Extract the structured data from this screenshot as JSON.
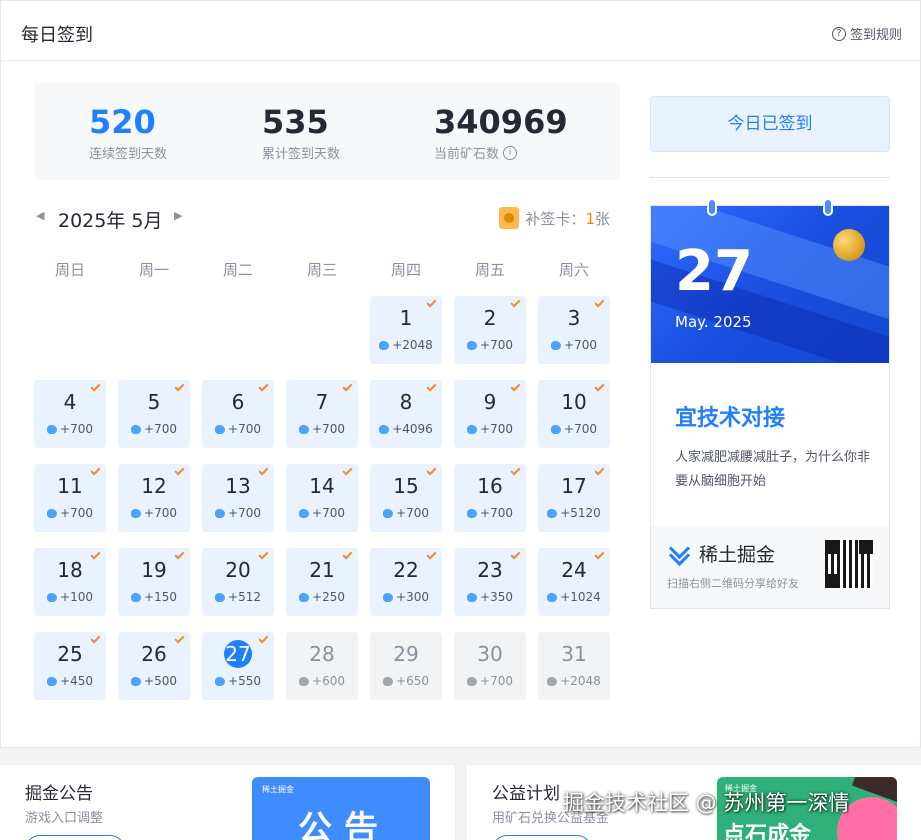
{
  "header": {
    "title": "每日签到",
    "rules_label": "签到规则",
    "rules_icon": "question-circle-icon"
  },
  "stats": {
    "streak": {
      "value": "520",
      "label": "连续签到天数"
    },
    "total": {
      "value": "535",
      "label": "累计签到天数"
    },
    "ore": {
      "value": "340969",
      "label": "当前矿石数",
      "info_icon": "i"
    }
  },
  "calendar": {
    "month_label": "2025年 5月",
    "prev_icon": "◀",
    "next_icon": "▶",
    "makeup_label": "补签卡：",
    "makeup_count": "1",
    "makeup_unit": "张",
    "weekdays": [
      "周日",
      "周一",
      "周二",
      "周三",
      "周四",
      "周五",
      "周六"
    ],
    "first_weekday_index": 4,
    "today": 27,
    "days": [
      {
        "day": "1",
        "reward": "+2048",
        "signed": true
      },
      {
        "day": "2",
        "reward": "+700",
        "signed": true
      },
      {
        "day": "3",
        "reward": "+700",
        "signed": true
      },
      {
        "day": "4",
        "reward": "+700",
        "signed": true
      },
      {
        "day": "5",
        "reward": "+700",
        "signed": true
      },
      {
        "day": "6",
        "reward": "+700",
        "signed": true
      },
      {
        "day": "7",
        "reward": "+700",
        "signed": true
      },
      {
        "day": "8",
        "reward": "+4096",
        "signed": true
      },
      {
        "day": "9",
        "reward": "+700",
        "signed": true
      },
      {
        "day": "10",
        "reward": "+700",
        "signed": true
      },
      {
        "day": "11",
        "reward": "+700",
        "signed": true
      },
      {
        "day": "12",
        "reward": "+700",
        "signed": true
      },
      {
        "day": "13",
        "reward": "+700",
        "signed": true
      },
      {
        "day": "14",
        "reward": "+700",
        "signed": true
      },
      {
        "day": "15",
        "reward": "+700",
        "signed": true
      },
      {
        "day": "16",
        "reward": "+700",
        "signed": true
      },
      {
        "day": "17",
        "reward": "+5120",
        "signed": true
      },
      {
        "day": "18",
        "reward": "+100",
        "signed": true
      },
      {
        "day": "19",
        "reward": "+150",
        "signed": true
      },
      {
        "day": "20",
        "reward": "+512",
        "signed": true
      },
      {
        "day": "21",
        "reward": "+250",
        "signed": true
      },
      {
        "day": "22",
        "reward": "+300",
        "signed": true
      },
      {
        "day": "23",
        "reward": "+350",
        "signed": true
      },
      {
        "day": "24",
        "reward": "+1024",
        "signed": true
      },
      {
        "day": "25",
        "reward": "+450",
        "signed": true
      },
      {
        "day": "26",
        "reward": "+500",
        "signed": true
      },
      {
        "day": "27",
        "reward": "+550",
        "signed": true
      },
      {
        "day": "28",
        "reward": "+600",
        "signed": false
      },
      {
        "day": "29",
        "reward": "+650",
        "signed": false
      },
      {
        "day": "30",
        "reward": "+700",
        "signed": false
      },
      {
        "day": "31",
        "reward": "+2048",
        "signed": false
      }
    ]
  },
  "sidebar": {
    "signed_button": "今日已签到",
    "promo": {
      "day": "27",
      "month_year": "May. 2025",
      "headline": "宜技术对接",
      "description": "人家减肥减腰减肚子，为什么你非要从脑细胞开始",
      "brand": "稀土掘金",
      "share_hint": "扫描右侧二维码分享给好友"
    }
  },
  "bottom": {
    "left": {
      "title": "掘金公告",
      "subtitle": "游戏入口调整",
      "banner_small": "稀土掘金",
      "banner_big": "公告"
    },
    "right": {
      "title": "公益计划",
      "subtitle": "用矿石兑换公益基金",
      "banner_small": "稀土掘金",
      "banner_big": "点石成金"
    }
  },
  "watermark": "掘金技术社区 @ 苏州第一深情",
  "colors": {
    "accent": "#1e80ff",
    "signed_bg": "#eaf2ff",
    "future_bg": "#f2f3f5",
    "check": "#f08c25",
    "makeup_count": "#ff7d00"
  }
}
